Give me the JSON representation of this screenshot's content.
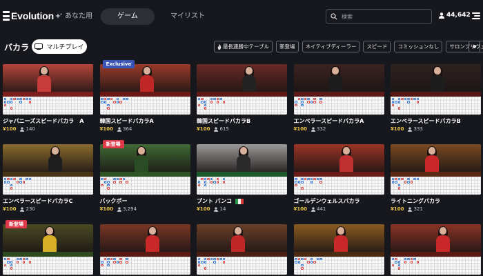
{
  "topbar": {
    "logo_text": "Evolution",
    "nav": {
      "for_you": "あなた用",
      "games": "ゲーム",
      "my_list": "マイリスト"
    },
    "search_placeholder": "検索",
    "player_count": "44,642"
  },
  "section": {
    "title": "バカラ",
    "mini_play_label": "マルチプレイ",
    "filters": [
      "最長連勝中テーブル",
      "新登場",
      "ネイティブディーラー",
      "スピード",
      "コミッションなし",
      "サロンプリヴェ・"
    ]
  },
  "colors": {
    "accent_price": "#e9c44a",
    "exclusive_badge": "#3b56b8",
    "new_badge": "#e03a4a",
    "background": "#16181d"
  },
  "games": [
    {
      "title": "ジャパニーズスピードバカラ　A",
      "price": "¥100",
      "players": "140",
      "badge": "",
      "flag": "",
      "scene": "#b4453a",
      "felt": "#7a1f1d",
      "dealer_color": "#c83b3b"
    },
    {
      "title": "韓国スピードバカラA",
      "price": "¥100",
      "players": "364",
      "badge": "Exclusive",
      "flag": "",
      "scene": "#9a3a2a",
      "felt": "#6a1916",
      "dealer_color": "#c02828"
    },
    {
      "title": "韓国スピードバカラB",
      "price": "¥100",
      "players": "615",
      "badge": "",
      "flag": "",
      "scene": "#6a2a24",
      "felt": "#5c1915",
      "dealer_color": "#222222"
    },
    {
      "title": "エンペラースピードバカラA",
      "price": "¥100",
      "players": "332",
      "badge": "",
      "flag": "",
      "scene": "#3a2220",
      "felt": "#5c1a18",
      "dealer_color": "#1d1d1d"
    },
    {
      "title": "エンペラースピードバカラB",
      "price": "¥100",
      "players": "333",
      "badge": "",
      "flag": "",
      "scene": "#2e2220",
      "felt": "#561816",
      "dealer_color": "#1d1d1d"
    },
    {
      "title": "エンペラースピードバカラC",
      "price": "¥100",
      "players": "230",
      "badge": "",
      "flag": "",
      "scene": "#8a6a2e",
      "felt": "#4a3418",
      "dealer_color": "#1e1e1e"
    },
    {
      "title": "バックボー",
      "price": "¥100",
      "players": "3,294",
      "badge": "新登場",
      "flag": "",
      "scene": "#3f6a34",
      "felt": "#2e5426",
      "dealer_color": "#2a4c24"
    },
    {
      "title": "プント バンコ",
      "price": "¥100",
      "players": "14",
      "badge": "",
      "flag": "italy",
      "scene": "#9a9a98",
      "felt": "#1d5a2c",
      "dealer_color": "#2a2a2a"
    },
    {
      "title": "ゴールデンウェルスバカラ",
      "price": "¥100",
      "players": "441",
      "badge": "",
      "flag": "",
      "scene": "#9a3424",
      "felt": "#6a1c18",
      "dealer_color": "#c03030"
    },
    {
      "title": "ライトニングバカラ",
      "price": "¥100",
      "players": "321",
      "badge": "",
      "flag": "",
      "scene": "#7a4a22",
      "felt": "#5a2a14",
      "dealer_color": "#c82828"
    },
    {
      "title": "",
      "price": "",
      "players": "",
      "badge": "新登場",
      "flag": "",
      "scene": "#4a4a22",
      "felt": "#2e4a1e",
      "dealer_color": "#d8b028"
    },
    {
      "title": "",
      "price": "",
      "players": "",
      "badge": "",
      "flag": "",
      "scene": "#7a3624",
      "felt": "#5a1a14",
      "dealer_color": "#c82828"
    },
    {
      "title": "",
      "price": "",
      "players": "",
      "badge": "",
      "flag": "",
      "scene": "#6a4028",
      "felt": "#4a1e14",
      "dealer_color": "#c02828"
    },
    {
      "title": "",
      "price": "",
      "players": "",
      "badge": "",
      "flag": "",
      "scene": "#8a5a20",
      "felt": "#4a2a10",
      "dealer_color": "#c82828"
    },
    {
      "title": "",
      "price": "",
      "players": "",
      "badge": "",
      "flag": "",
      "scene": "#8a3424",
      "felt": "#5a1a14",
      "dealer_color": "#c82828"
    }
  ]
}
